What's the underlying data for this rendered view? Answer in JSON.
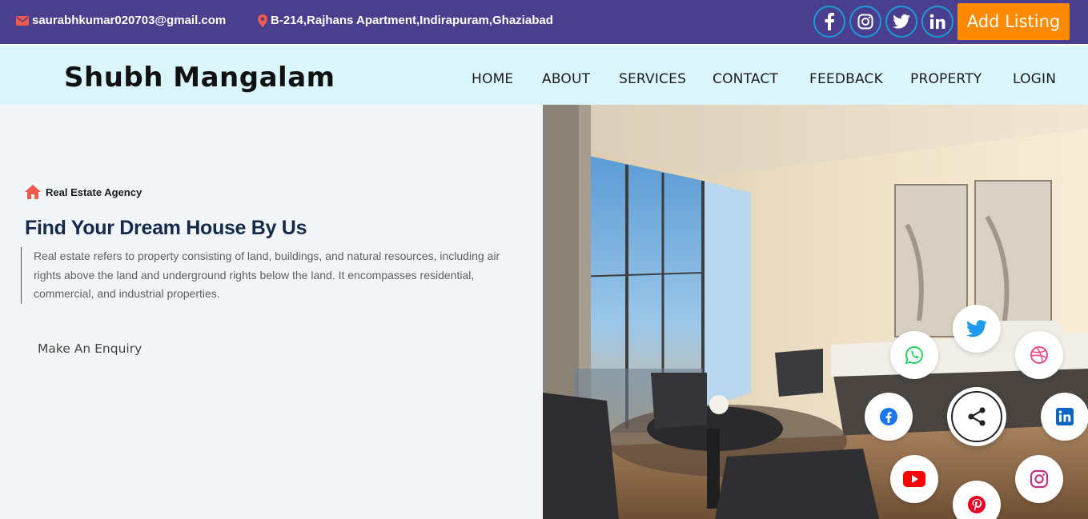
{
  "topbar": {
    "email": "saurabhkumar020703@gmail.com",
    "address": "B-214,Rajhans Apartment,Indirapuram,Ghaziabad",
    "add_listing": "Add Listing",
    "socials": [
      "facebook-icon",
      "instagram-icon",
      "twitter-icon",
      "linkedin-icon"
    ]
  },
  "nav": {
    "brand": "Shubh Mangalam",
    "links": [
      "HOME",
      "ABOUT",
      "SERVICES",
      "CONTACT",
      "FEEDBACK",
      "PROPERTY",
      "LOGIN"
    ]
  },
  "hero": {
    "tag": "Real Estate Agency",
    "headline": "Find Your Dream House By Us",
    "description": "Real estate refers to property consisting of land, buildings, and natural resources, including air rights above the land and underground rights below the land. It encompasses residential, commercial, and industrial properties.",
    "cta": "Make An Enquiry"
  },
  "share_menu": {
    "center": "share-icon",
    "items": [
      "twitter-icon",
      "dribbble-icon",
      "linkedin-icon",
      "instagram-icon",
      "pinterest-icon",
      "youtube-icon",
      "facebook-icon",
      "whatsapp-icon"
    ]
  },
  "colors": {
    "topbar_bg": "#4a3f8f",
    "nav_bg": "#daf5fb",
    "accent_orange": "#ff8a00",
    "headline": "#14294b",
    "icon_red": "#f05a4a"
  }
}
